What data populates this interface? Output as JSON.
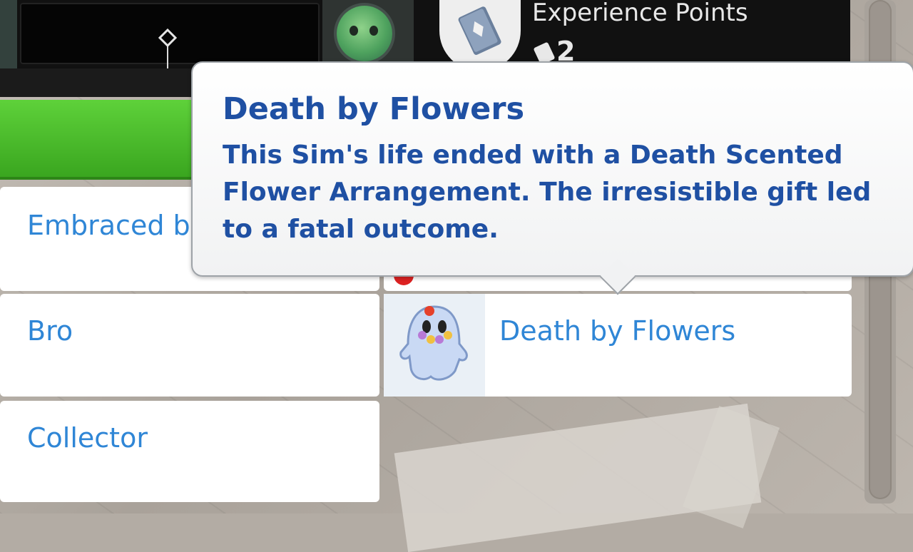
{
  "hud": {
    "xp_label": "Experience Points",
    "xp_count": "2",
    "xp_icon": "book-icon",
    "emotion_icon": "happy-emotion-icon",
    "gauge_marker_icon": "diamond-marker-icon"
  },
  "traits": {
    "items": [
      {
        "label": "Embraced b",
        "icon": "embraced-trait-icon"
      },
      {
        "label": "Bro",
        "icon": "bro-trait-icon"
      },
      {
        "label": "Collector",
        "icon": "collector-trait-icon"
      },
      {
        "label": "Death by Flowers",
        "icon": "ghost-flowers-icon"
      }
    ]
  },
  "tooltip": {
    "title": "Death by Flowers",
    "body": "This Sim's life ended with a Death Scented Flower Arrangement. The irresistible gift led to a fatal outcome."
  },
  "colors": {
    "accent_text": "#2f86d6",
    "tooltip_text": "#1f50a3",
    "progress_green": "#4cc02c"
  }
}
